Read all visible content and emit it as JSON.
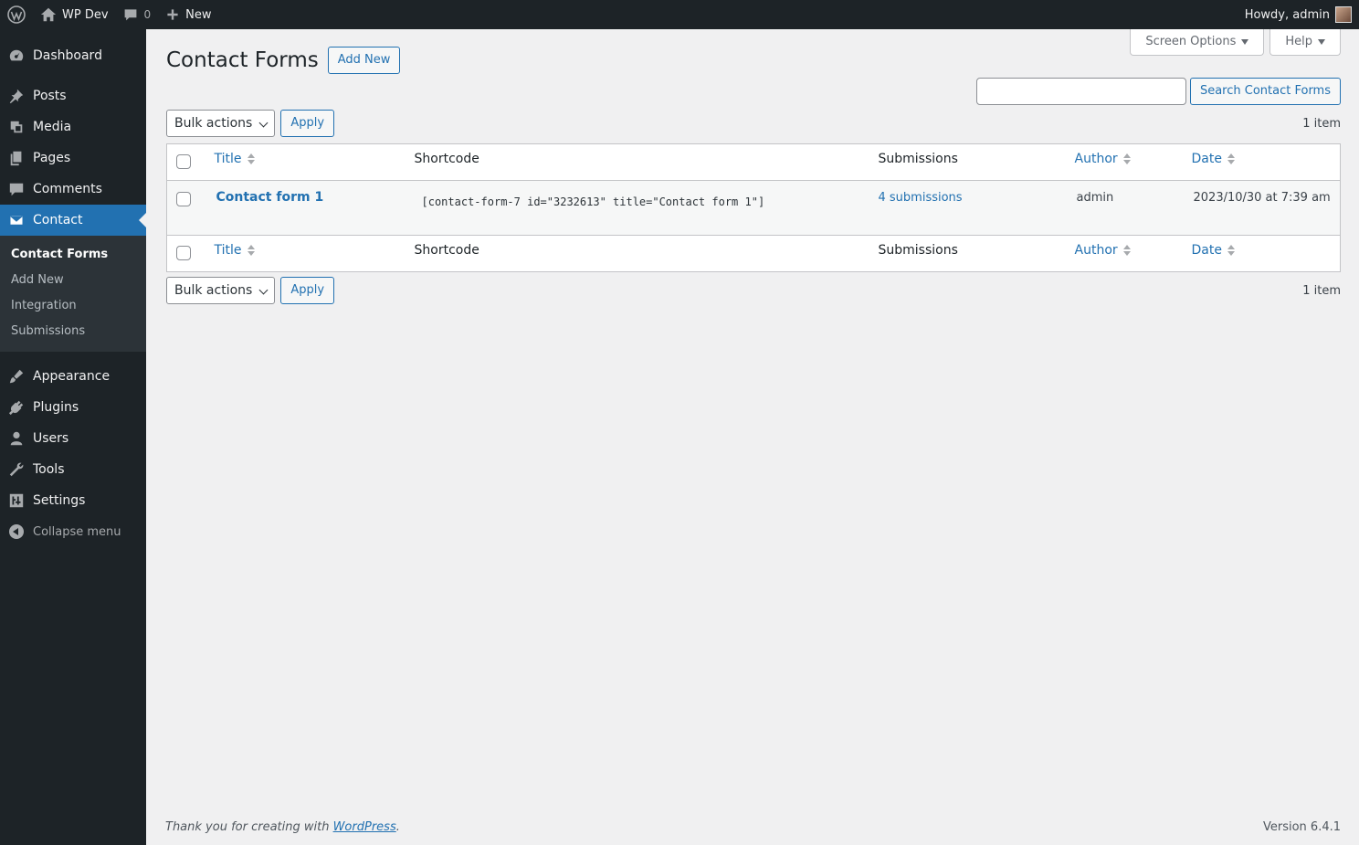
{
  "adminbar": {
    "site_name": "WP Dev",
    "comments_count": "0",
    "new_label": "New",
    "greeting": "Howdy, admin"
  },
  "sidebar": {
    "items": [
      {
        "label": "Dashboard",
        "icon": "dashboard-icon"
      },
      {
        "label": "Posts",
        "icon": "pin-icon"
      },
      {
        "label": "Media",
        "icon": "media-icon"
      },
      {
        "label": "Pages",
        "icon": "pages-icon"
      },
      {
        "label": "Comments",
        "icon": "comment-icon"
      },
      {
        "label": "Contact",
        "icon": "envelope-icon",
        "current": true
      },
      {
        "label": "Appearance",
        "icon": "brush-icon"
      },
      {
        "label": "Plugins",
        "icon": "plug-icon"
      },
      {
        "label": "Users",
        "icon": "user-icon"
      },
      {
        "label": "Tools",
        "icon": "wrench-icon"
      },
      {
        "label": "Settings",
        "icon": "settings-icon"
      }
    ],
    "submenu": [
      "Contact Forms",
      "Add New",
      "Integration",
      "Submissions"
    ],
    "collapse_label": "Collapse menu"
  },
  "screen_meta": {
    "screen_options": "Screen Options",
    "help": "Help"
  },
  "page": {
    "title": "Contact Forms",
    "add_new": "Add New",
    "search_placeholder": "",
    "search_button": "Search Contact Forms",
    "bulk_actions": "Bulk actions",
    "apply": "Apply",
    "item_count": "1 item"
  },
  "table": {
    "columns": [
      "Title",
      "Shortcode",
      "Submissions",
      "Author",
      "Date"
    ],
    "rows": [
      {
        "title": "Contact form 1",
        "shortcode": "[contact-form-7 id=\"3232613\" title=\"Contact form 1\"]",
        "submissions": "4 submissions",
        "author": "admin",
        "date": "2023/10/30 at 7:39 am"
      }
    ]
  },
  "footer": {
    "thanks_prefix": "Thank you for creating with ",
    "thanks_link": "WordPress",
    "thanks_suffix": ".",
    "version": "Version 6.4.1"
  },
  "colors": {
    "accent": "#2271b1",
    "admin_bg": "#1d2327",
    "page_bg": "#f0f0f1"
  }
}
